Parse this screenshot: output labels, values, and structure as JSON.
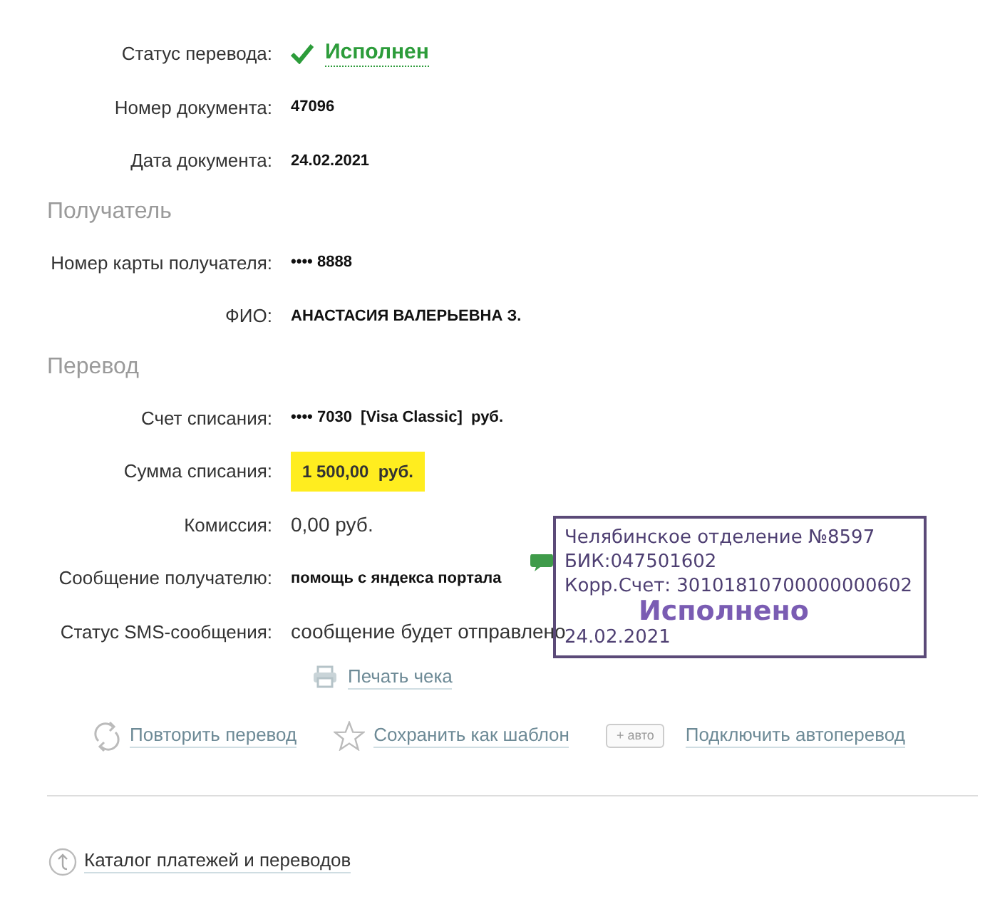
{
  "details": [
    {
      "kind": "status",
      "label": "Статус перевода:",
      "value": "Исполнен"
    },
    {
      "kind": "bold",
      "label": "Номер документа:",
      "value": "47096"
    },
    {
      "kind": "bold",
      "label": "Дата документа:",
      "value": "24.02.2021"
    },
    {
      "kind": "heading",
      "label": "Получатель"
    },
    {
      "kind": "bold",
      "label": "Номер карты получателя:",
      "value": "•••• 8888"
    },
    {
      "kind": "bold",
      "label": "ФИО:",
      "value": "АНАСТАСИЯ ВАЛЕРЬЕВНА З."
    },
    {
      "kind": "heading",
      "label": "Перевод"
    },
    {
      "kind": "bold",
      "label": "Счет списания:",
      "value": "•••• 7030  [Visa Classic]  руб."
    },
    {
      "kind": "highlight",
      "label": "Сумма списания:",
      "value": "1 500,00  руб."
    },
    {
      "kind": "plain",
      "label": "Комиссия:",
      "value": "0,00 руб."
    },
    {
      "kind": "bold",
      "label": "Сообщение получателю:",
      "value": "помощь с яндекса портала"
    },
    {
      "kind": "plain",
      "label": "Статус SMS-сообщения:",
      "value": "сообщение будет отправлено"
    }
  ],
  "print_link": "Печать чека",
  "actions": [
    {
      "kind": "repeat",
      "label": "Повторить перевод"
    },
    {
      "kind": "star",
      "label": "Сохранить как шаблон"
    },
    {
      "kind": "auto",
      "badge": "+ авто",
      "label": "Подключить автоперевод"
    }
  ],
  "catalog_link": "Каталог платежей и переводов",
  "stamp": {
    "lines": [
      "Челябинское отделение №8597",
      "БИК:047501602",
      "Корр.Счет: 30101810700000000602"
    ],
    "mark": "Исполнено",
    "date": "24.02.2021"
  }
}
